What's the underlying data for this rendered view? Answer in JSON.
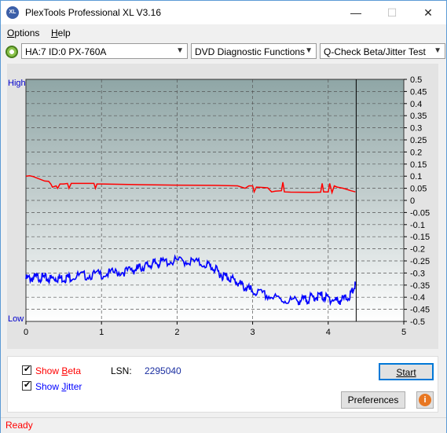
{
  "window": {
    "title": "PlexTools Professional XL V3.16",
    "app_icon_text": "XL",
    "minimize": "—",
    "maximize": "☐",
    "close": "✕"
  },
  "menu": [
    {
      "label": "Options"
    },
    {
      "label": "Help"
    }
  ],
  "toolbar": {
    "drive": "HA:7 ID:0  PX-760A",
    "function": "DVD Diagnostic Functions",
    "test": "Q-Check Beta/Jitter Test"
  },
  "chart_data": {
    "type": "line",
    "y_left_labels": {
      "high": "High",
      "low": "Low"
    },
    "x_ticks": [
      "0",
      "1",
      "2",
      "3",
      "4",
      "5"
    ],
    "xlim": [
      0,
      5
    ],
    "y_right_ticks": [
      "0.5",
      "0.45",
      "0.4",
      "0.35",
      "0.3",
      "0.25",
      "0.2",
      "0.15",
      "0.1",
      "0.05",
      "0",
      "-0.05",
      "-0.1",
      "-0.15",
      "-0.2",
      "-0.25",
      "-0.3",
      "-0.35",
      "-0.4",
      "-0.45",
      "-0.5"
    ],
    "ylim": [
      -0.5,
      0.5
    ],
    "grid": true,
    "end_marker_x": 4.37,
    "series": [
      {
        "name": "Beta",
        "color": "#ff0000",
        "points": [
          [
            0,
            0.1
          ],
          [
            0.05,
            0.102
          ],
          [
            0.1,
            0.098
          ],
          [
            0.25,
            0.08
          ],
          [
            0.3,
            0.079
          ],
          [
            0.33,
            0.068
          ],
          [
            0.35,
            0.055
          ],
          [
            0.4,
            0.06
          ],
          [
            0.42,
            0.05
          ],
          [
            0.45,
            0.068
          ],
          [
            0.5,
            0.068
          ],
          [
            0.55,
            0.07
          ],
          [
            0.57,
            0.05
          ],
          [
            0.6,
            0.07
          ],
          [
            0.9,
            0.07
          ],
          [
            0.92,
            0.05
          ],
          [
            0.94,
            0.068
          ],
          [
            1.0,
            0.068
          ],
          [
            1.5,
            0.065
          ],
          [
            2.0,
            0.063
          ],
          [
            2.5,
            0.062
          ],
          [
            2.8,
            0.06
          ],
          [
            2.9,
            0.05
          ],
          [
            2.95,
            0.06
          ],
          [
            3.0,
            0.06
          ],
          [
            3.02,
            0.035
          ],
          [
            3.05,
            0.055
          ],
          [
            3.1,
            0.054
          ],
          [
            3.2,
            0.052
          ],
          [
            3.25,
            0.035
          ],
          [
            3.3,
            0.038
          ],
          [
            3.38,
            0.04
          ],
          [
            3.4,
            0.075
          ],
          [
            3.42,
            0.035
          ],
          [
            3.5,
            0.034
          ],
          [
            3.8,
            0.033
          ],
          [
            3.9,
            0.034
          ],
          [
            3.92,
            0.07
          ],
          [
            3.94,
            0.035
          ],
          [
            4.0,
            0.035
          ],
          [
            4.02,
            0.07
          ],
          [
            4.05,
            0.032
          ],
          [
            4.08,
            0.06
          ],
          [
            4.12,
            0.055
          ],
          [
            4.2,
            0.05
          ],
          [
            4.3,
            0.04
          ],
          [
            4.36,
            0.035
          ]
        ]
      },
      {
        "name": "Jitter",
        "color": "#0000ff",
        "points": [
          [
            0,
            -0.325
          ],
          [
            0.1,
            -0.32
          ],
          [
            0.2,
            -0.318
          ],
          [
            0.3,
            -0.325
          ],
          [
            0.4,
            -0.32
          ],
          [
            0.5,
            -0.322
          ],
          [
            0.6,
            -0.315
          ],
          [
            0.8,
            -0.31
          ],
          [
            1.0,
            -0.305
          ],
          [
            1.2,
            -0.298
          ],
          [
            1.4,
            -0.29
          ],
          [
            1.5,
            -0.28
          ],
          [
            1.6,
            -0.27
          ],
          [
            1.7,
            -0.26
          ],
          [
            1.8,
            -0.255
          ],
          [
            2.0,
            -0.25
          ],
          [
            2.2,
            -0.253
          ],
          [
            2.4,
            -0.265
          ],
          [
            2.5,
            -0.285
          ],
          [
            2.6,
            -0.31
          ],
          [
            2.7,
            -0.32
          ],
          [
            2.8,
            -0.34
          ],
          [
            2.9,
            -0.36
          ],
          [
            3.0,
            -0.375
          ],
          [
            3.2,
            -0.395
          ],
          [
            3.4,
            -0.412
          ],
          [
            3.6,
            -0.415
          ],
          [
            3.7,
            -0.41
          ],
          [
            3.8,
            -0.4
          ],
          [
            3.9,
            -0.395
          ],
          [
            4.0,
            -0.405
          ],
          [
            4.1,
            -0.415
          ],
          [
            4.2,
            -0.41
          ],
          [
            4.3,
            -0.39
          ],
          [
            4.36,
            -0.35
          ]
        ]
      }
    ]
  },
  "controls": {
    "show_beta_checked": true,
    "show_beta_pre": "Show ",
    "show_beta_accel": "B",
    "show_beta_post": "eta",
    "show_jitter_checked": true,
    "show_jitter_pre": "Show ",
    "show_jitter_accel": "J",
    "show_jitter_post": "itter",
    "lsn_label": "LSN:",
    "lsn_value": "2295040",
    "start_button": "Start",
    "preferences_button": "Preferences",
    "info_icon": "info-icon",
    "beta_color": "#ff0000",
    "jitter_color": "#0000ff"
  },
  "status": {
    "text": "Ready",
    "color": "#ff0000"
  }
}
